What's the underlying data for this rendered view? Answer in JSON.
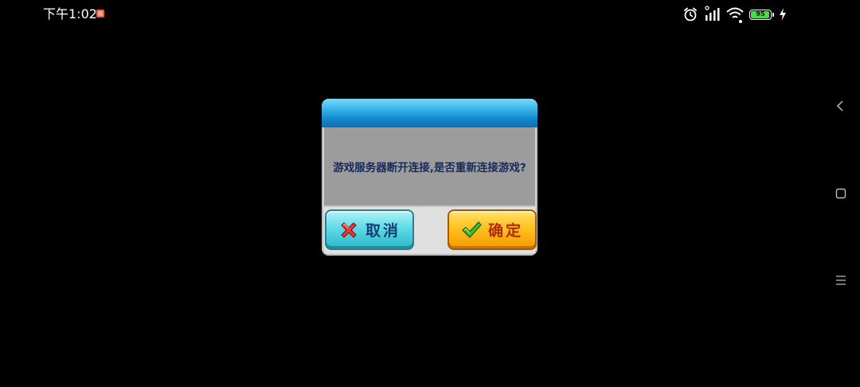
{
  "status_bar": {
    "time": "下午1:02",
    "battery_level": "95",
    "battery_fraction": 0.95,
    "icons": [
      "notification-icon",
      "alarm-icon",
      "signal-icon",
      "wifi-icon",
      "battery-icon",
      "charging-icon"
    ]
  },
  "nav": {
    "icons": [
      "back-icon",
      "home-icon",
      "recents-icon"
    ]
  },
  "dialog": {
    "message": "游戏服务器断开连接,是否重新连接游戏?",
    "cancel_label": "取消",
    "confirm_label": "确定"
  },
  "colors": {
    "header_blue": "#1588cc",
    "cancel_teal": "#5fdbe6",
    "confirm_orange": "#ffc21f",
    "cancel_icon_red": "#e83a3a",
    "confirm_icon_green": "#3fbf2a",
    "battery_green": "#4cd94c"
  }
}
